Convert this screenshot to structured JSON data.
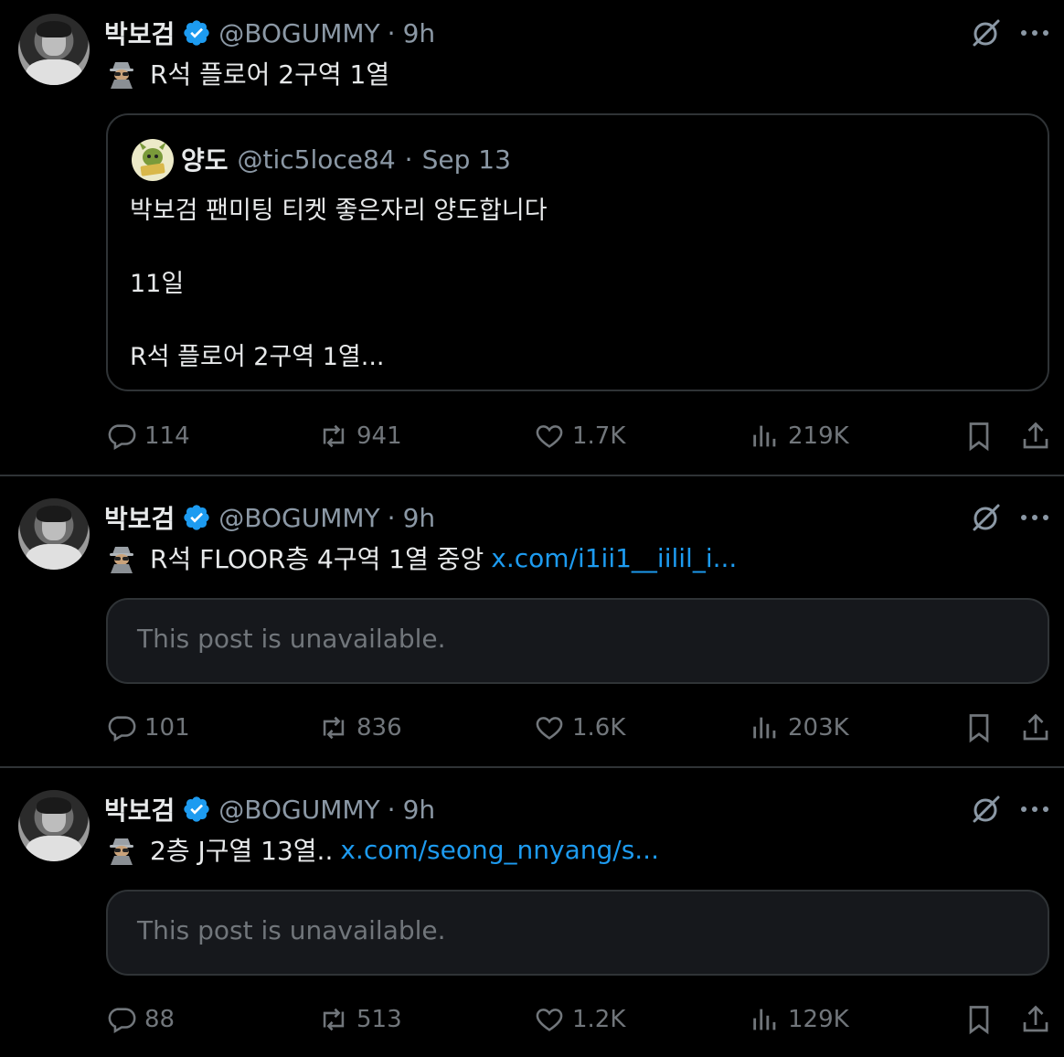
{
  "tweets": [
    {
      "name": "박보검",
      "handle": "@BOGUMMY",
      "sep": "·",
      "time": "9h",
      "text": "R석 플로어 2구역 1열",
      "link": "",
      "quote": {
        "name": "양도",
        "handle": "@tic5loce84",
        "sep": "·",
        "date": "Sep 13",
        "line1": "박보검 팬미팅 티켓 좋은자리 양도합니다",
        "line2": "11일",
        "line3": "R석 플로어 2구역 1열..."
      },
      "stats": {
        "replies": "114",
        "reposts": "941",
        "likes": "1.7K",
        "views": "219K"
      }
    },
    {
      "name": "박보검",
      "handle": "@BOGUMMY",
      "sep": "·",
      "time": "9h",
      "text": "R석 FLOOR층 4구역 1열 중앙",
      "link": "x.com/i1ii1__iilil_i...",
      "unavailable": "This post is unavailable.",
      "stats": {
        "replies": "101",
        "reposts": "836",
        "likes": "1.6K",
        "views": "203K"
      }
    },
    {
      "name": "박보검",
      "handle": "@BOGUMMY",
      "sep": "·",
      "time": "9h",
      "text": "2층 J구열 13열..",
      "link": "x.com/seong_nnyang/s...",
      "unavailable": "This post is unavailable.",
      "stats": {
        "replies": "88",
        "reposts": "513",
        "likes": "1.2K",
        "views": "129K"
      }
    }
  ],
  "colors": {
    "background": "#000000",
    "text": "#e7e9ea",
    "muted": "#71767b",
    "link": "#1d9bf0",
    "verified": "#1d9bf0",
    "border": "#2f3336"
  },
  "icons": [
    "verified-badge-icon",
    "grok-icon",
    "more-icon",
    "spy-emoji-icon",
    "reply-icon",
    "repost-icon",
    "like-icon",
    "views-icon",
    "bookmark-icon",
    "share-icon"
  ]
}
